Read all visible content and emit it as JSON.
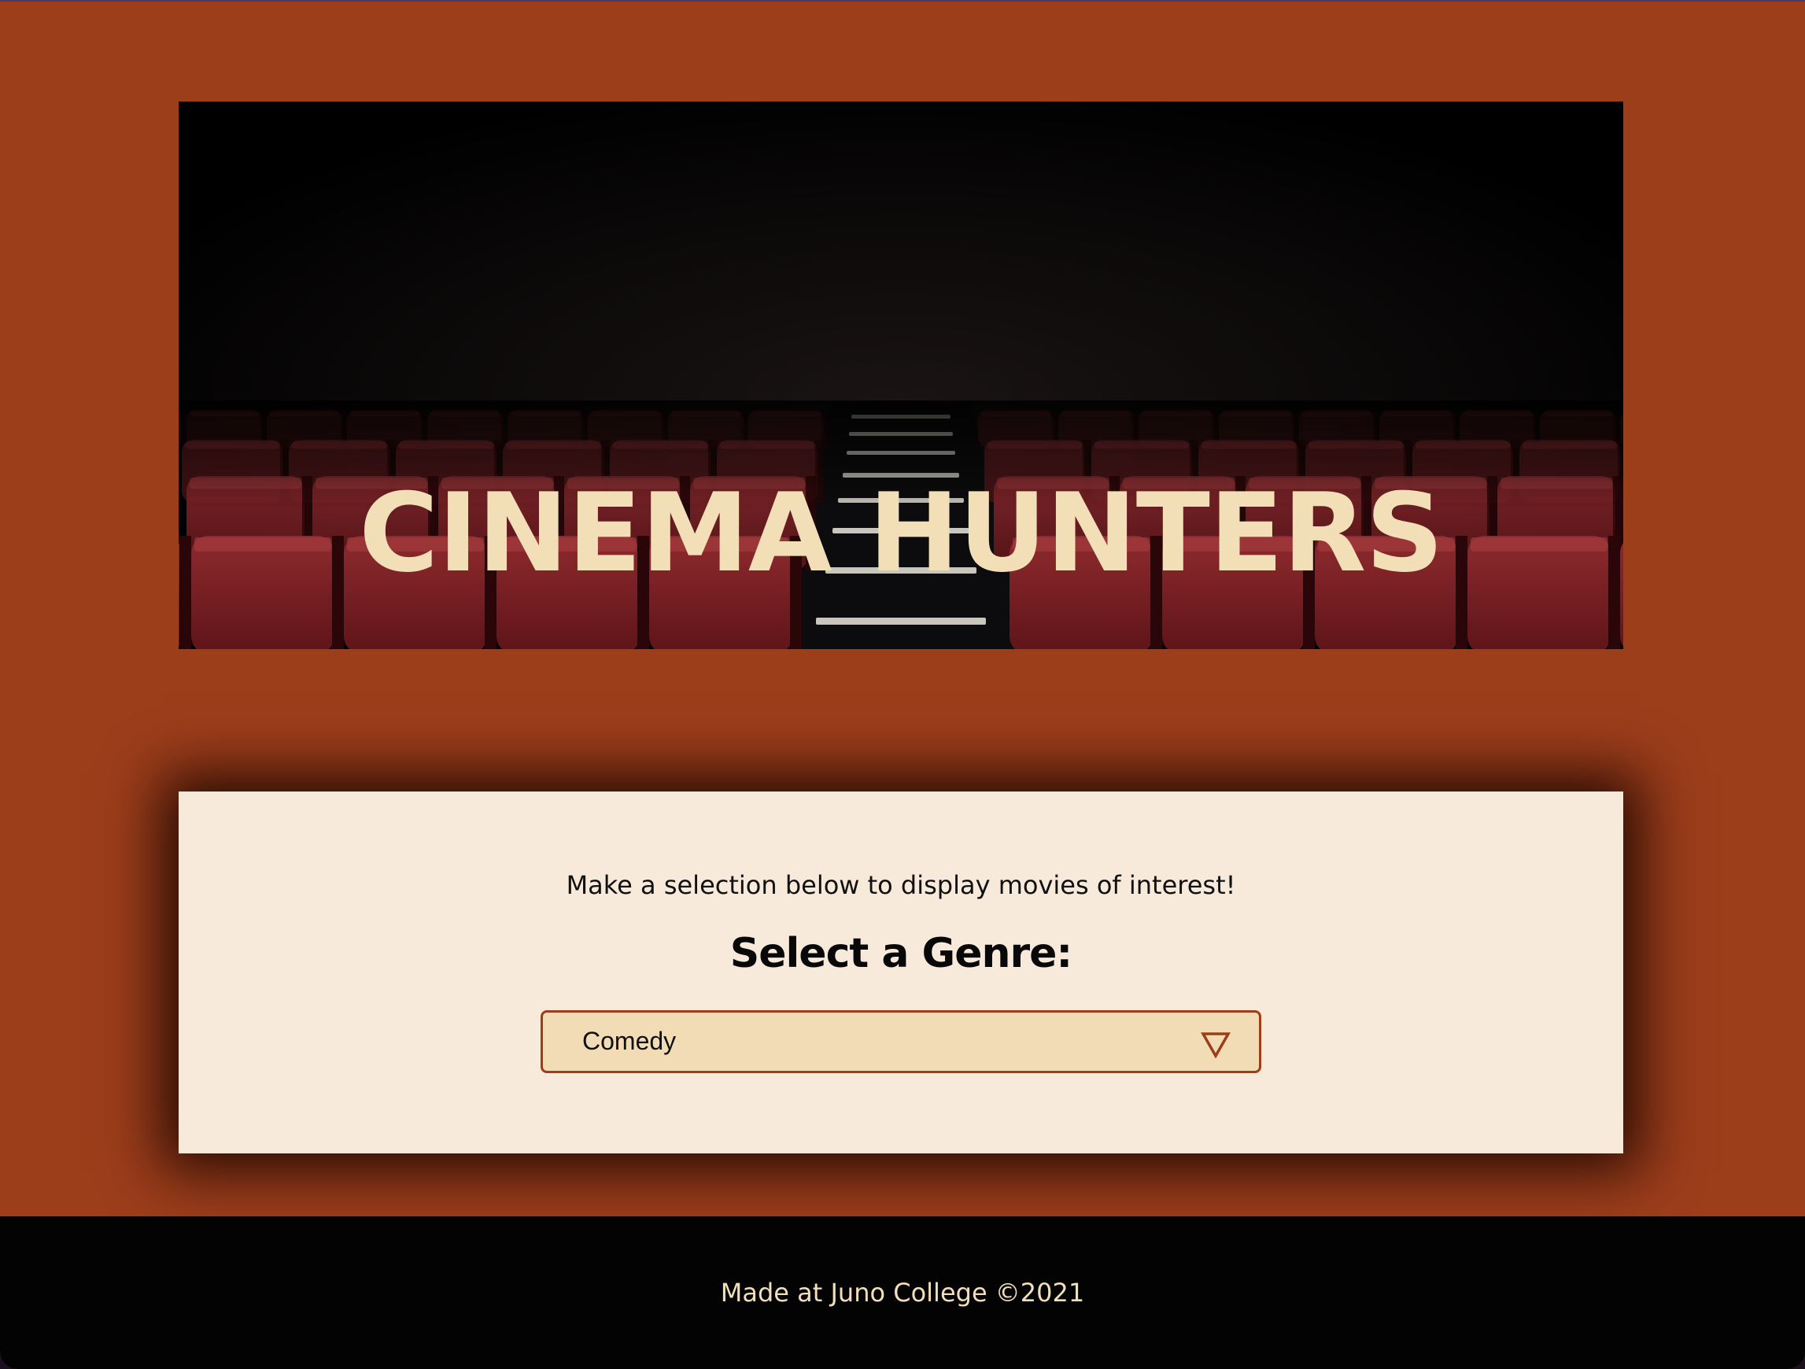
{
  "colors": {
    "page_background": "#9d3e1b",
    "title_color": "#f2dfb8",
    "card_background": "#f7eadb",
    "select_background": "#f1dcb6",
    "select_border": "#9d3e1b",
    "footer_background": "#040303",
    "footer_text": "#f2dfb8",
    "seat_red": "#7a1e22"
  },
  "hero": {
    "title": "CINEMA HUNTERS",
    "image": "theater-seats-image"
  },
  "selection": {
    "intro": "Make a selection below to display movies of interest!",
    "label": "Select a Genre:",
    "selected_genre": "Comedy",
    "arrow_icon": "triangle-down-icon"
  },
  "footer": {
    "text": "Made at Juno College ©2021"
  }
}
